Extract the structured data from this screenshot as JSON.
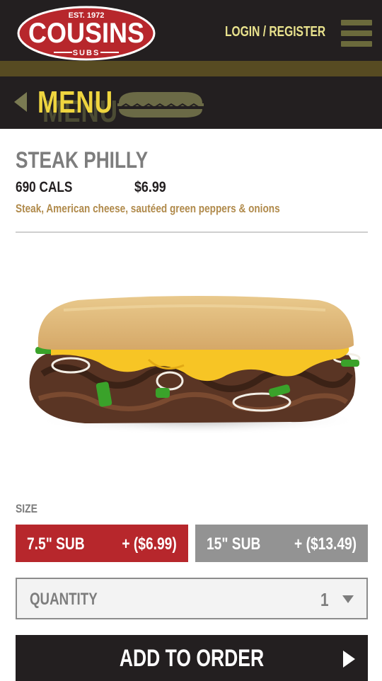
{
  "header": {
    "logo_top": "EST. 1972",
    "logo_main": "COUSINS",
    "logo_bottom": "SUBS",
    "login_label": "LOGIN / REGISTER"
  },
  "nav": {
    "title": "MENU"
  },
  "product": {
    "name": "STEAK PHILLY",
    "calories": "690 CALS",
    "price": "$6.99",
    "description": "Steak, American cheese, sautéed green peppers & onions"
  },
  "size": {
    "label": "SIZE",
    "options": [
      {
        "label": "7.5\" SUB",
        "price": "+ ($6.99)",
        "selected": true
      },
      {
        "label": "15\" SUB",
        "price": "+ ($13.49)",
        "selected": false
      }
    ]
  },
  "quantity": {
    "label": "QUANTITY",
    "value": "1"
  },
  "add_to_order": {
    "label": "ADD TO ORDER"
  },
  "colors": {
    "dark": "#231f20",
    "brand_red": "#b7272c",
    "accent_yellow": "#efd53f",
    "login_yellow": "#e9e28d",
    "olive": "#574b22",
    "gray_button": "#939393",
    "description_tan": "#b08a4b"
  }
}
